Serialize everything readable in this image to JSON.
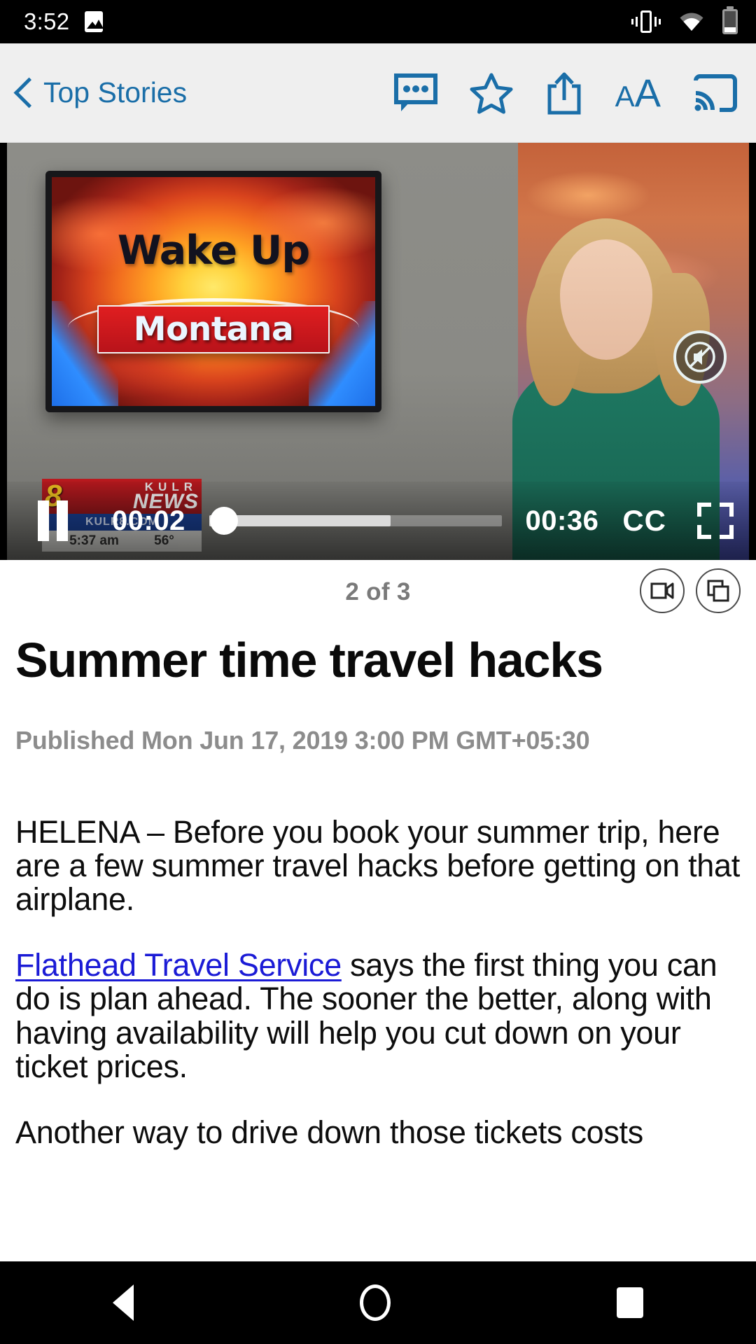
{
  "status_bar": {
    "time": "3:52",
    "icons": [
      "screenshot-image-icon",
      "vibrate-icon",
      "wifi-icon",
      "battery-icon"
    ]
  },
  "toolbar": {
    "back_label": "Top Stories",
    "back_icon": "chevron-left-icon",
    "accent_color": "#1a6ea8",
    "background_color": "#efefef",
    "actions": [
      {
        "name": "comments",
        "icon": "comment-bubble-icon"
      },
      {
        "name": "favorite",
        "icon": "star-outline-icon"
      },
      {
        "name": "share",
        "icon": "share-upload-icon"
      },
      {
        "name": "text-size",
        "icon": "text-size-aa-icon",
        "label_small": "A",
        "label_large": "A"
      },
      {
        "name": "cast",
        "icon": "cast-screen-icon"
      }
    ]
  },
  "video": {
    "tv_graphic": {
      "line1": "Wake Up",
      "line2": "Montana"
    },
    "station_bug": {
      "channel": "8",
      "call_letters": "KULR",
      "news_word": "NEWS",
      "website": "KULR8.COM",
      "clock": "5:37 am",
      "temperature": "56°"
    },
    "mute_icon": "speaker-muted-icon",
    "is_muted": true,
    "controls": {
      "play_state_icon": "pause-icon",
      "elapsed": "00:02",
      "duration": "00:36",
      "cc_label": "CC",
      "fullscreen_icon": "fullscreen-expand-icon",
      "progress_percent": 5,
      "buffered_percent": 62
    }
  },
  "article": {
    "counter": "2 of 3",
    "actions": [
      {
        "name": "video-mode",
        "icon": "video-camera-icon"
      },
      {
        "name": "gallery-mode",
        "icon": "copy-layers-icon"
      }
    ],
    "headline": "Summer time travel hacks",
    "published": "Published Mon Jun 17, 2019 3:00 PM GMT+05:30",
    "paragraph_1": "HELENA – Before you book your summer trip, here are a few summer travel hacks before getting on that airplane.",
    "link_text": "Flathead Travel Service",
    "link_color": "#1b1bd6",
    "paragraph_2_rest": " says the first thing you can do is plan ahead. The sooner the better, along with having availability will help you cut down on your ticket prices.",
    "paragraph_3": "Another way to drive down those tickets costs"
  },
  "nav_bar": {
    "back_icon": "triangle-back-icon",
    "home_icon": "circle-home-icon",
    "recents_icon": "square-recents-icon"
  }
}
